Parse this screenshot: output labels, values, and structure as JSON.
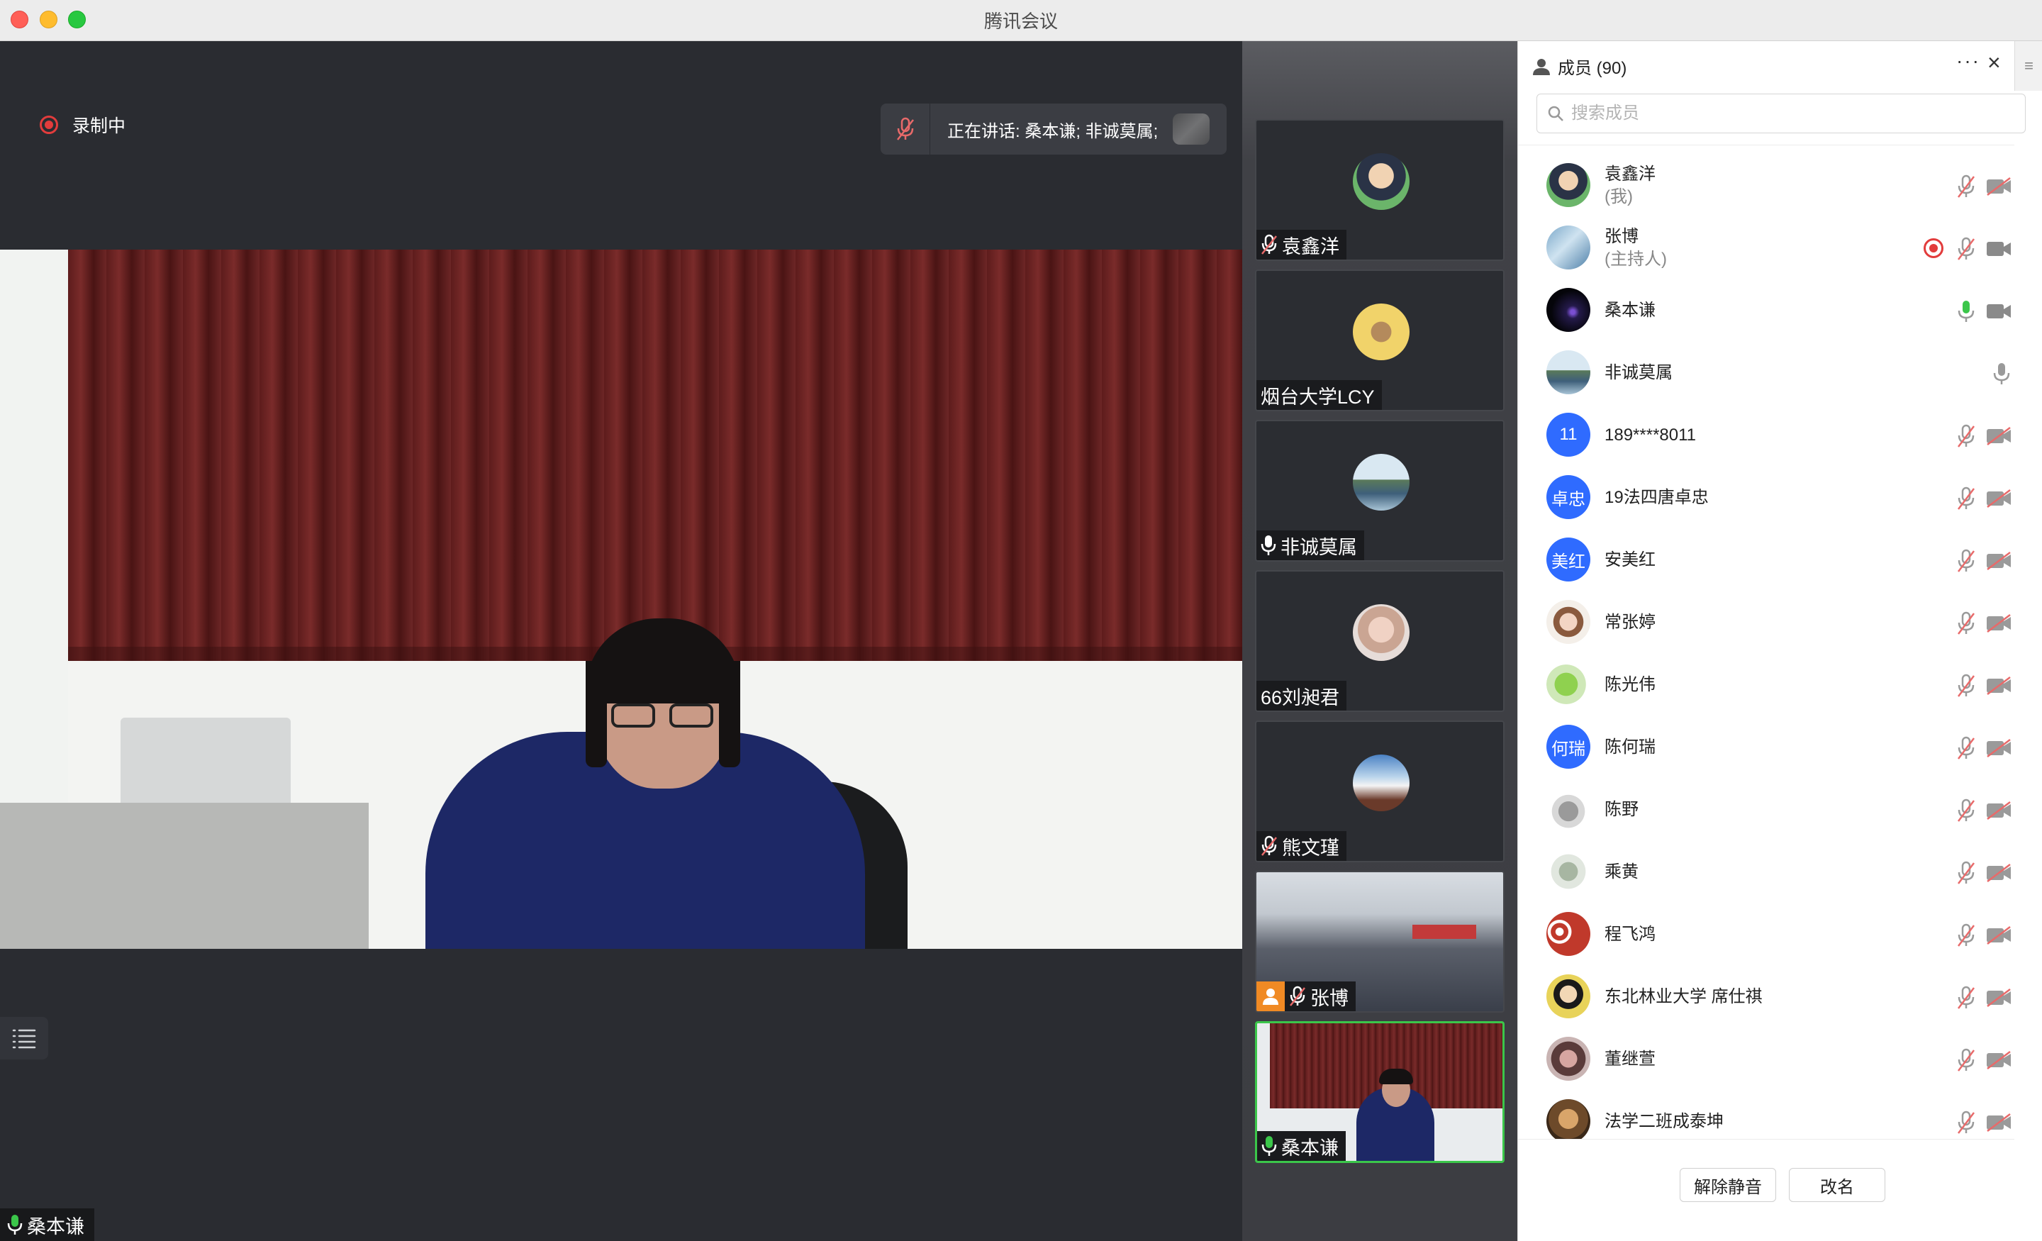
{
  "window": {
    "title": "腾讯会议"
  },
  "stage": {
    "recording_label": "录制中",
    "speaking_text": "正在讲话: 桑本谦; 非诚莫属;",
    "main_speaker_name": "桑本谦"
  },
  "thumbnails": [
    {
      "name": "袁鑫洋",
      "mic": "muted"
    },
    {
      "name": "烟台大学LCY",
      "mic": "none"
    },
    {
      "name": "非诚莫属",
      "mic": "on"
    },
    {
      "name": "66刘昶君",
      "mic": "none"
    },
    {
      "name": "熊文瑾",
      "mic": "muted"
    },
    {
      "name": "张博",
      "mic": "muted",
      "host": true
    },
    {
      "name": "桑本谦",
      "mic": "active",
      "active": true
    }
  ],
  "panel": {
    "title": "成员 (90)",
    "more_icon": "more-dots-icon",
    "close_icon": "close-icon",
    "search_placeholder": "搜索成员",
    "members": [
      {
        "name": "袁鑫洋",
        "sub": "(我)",
        "avatar_text": "",
        "mic": "muted",
        "cam": "off"
      },
      {
        "name": "张博",
        "sub": "(主持人)",
        "avatar_text": "",
        "mic": "muted",
        "cam": "on",
        "recording": true
      },
      {
        "name": "桑本谦",
        "sub": "",
        "avatar_text": "",
        "mic": "active",
        "cam": "on"
      },
      {
        "name": "非诚莫属",
        "sub": "",
        "avatar_text": "",
        "mic": "on-only"
      },
      {
        "name": "189****8011",
        "sub": "",
        "avatar_text": "11",
        "mic": "muted",
        "cam": "off"
      },
      {
        "name": "19法四唐卓忠",
        "sub": "",
        "avatar_text": "卓忠",
        "mic": "muted",
        "cam": "off"
      },
      {
        "name": "安美红",
        "sub": "",
        "avatar_text": "美红",
        "mic": "muted",
        "cam": "off"
      },
      {
        "name": "常张婷",
        "sub": "",
        "avatar_text": "",
        "mic": "muted",
        "cam": "off"
      },
      {
        "name": "陈光伟",
        "sub": "",
        "avatar_text": "",
        "mic": "muted",
        "cam": "off"
      },
      {
        "name": "陈何瑞",
        "sub": "",
        "avatar_text": "何瑞",
        "mic": "muted",
        "cam": "off"
      },
      {
        "name": "陈野",
        "sub": "",
        "avatar_text": "",
        "mic": "muted",
        "cam": "off"
      },
      {
        "name": "乘黄",
        "sub": "",
        "avatar_text": "",
        "mic": "muted",
        "cam": "off"
      },
      {
        "name": "程飞鸿",
        "sub": "",
        "avatar_text": "",
        "mic": "muted",
        "cam": "off"
      },
      {
        "name": "东北林业大学 席仕祺",
        "sub": "",
        "avatar_text": "",
        "mic": "muted",
        "cam": "off"
      },
      {
        "name": "董继萱",
        "sub": "",
        "avatar_text": "",
        "mic": "muted",
        "cam": "off"
      },
      {
        "name": "法学二班成泰坤",
        "sub": "",
        "avatar_text": "",
        "mic": "muted",
        "cam": "off"
      }
    ],
    "unmute_button": "解除静音",
    "rename_button": "改名"
  },
  "colors": {
    "accent_blue": "#2f6bff",
    "active_green": "#3bc64a",
    "record_red": "#e23c3c",
    "host_orange": "#f08a24"
  }
}
